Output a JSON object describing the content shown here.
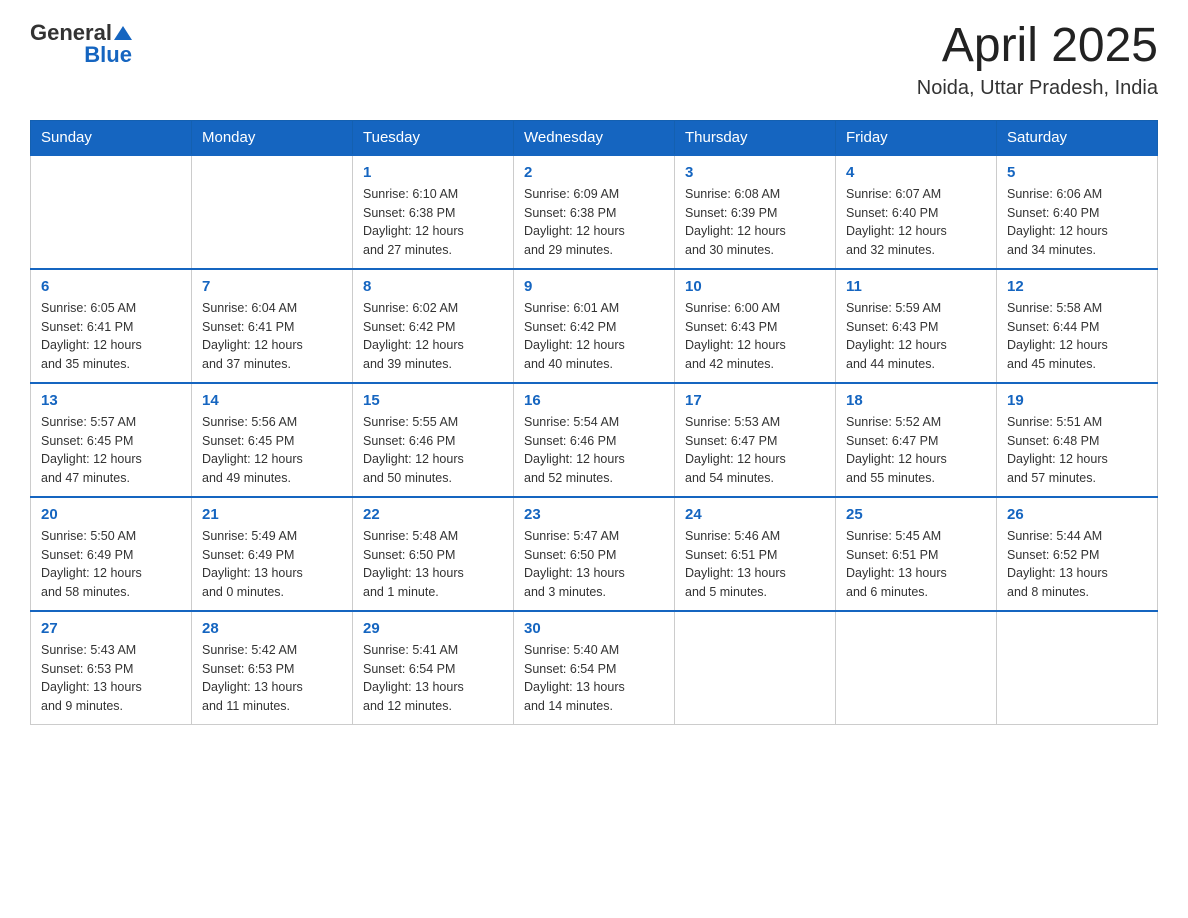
{
  "header": {
    "logo_general": "General",
    "logo_blue": "Blue",
    "title": "April 2025",
    "subtitle": "Noida, Uttar Pradesh, India"
  },
  "days_of_week": [
    "Sunday",
    "Monday",
    "Tuesday",
    "Wednesday",
    "Thursday",
    "Friday",
    "Saturday"
  ],
  "weeks": [
    [
      {
        "day": "",
        "info": ""
      },
      {
        "day": "",
        "info": ""
      },
      {
        "day": "1",
        "info": "Sunrise: 6:10 AM\nSunset: 6:38 PM\nDaylight: 12 hours\nand 27 minutes."
      },
      {
        "day": "2",
        "info": "Sunrise: 6:09 AM\nSunset: 6:38 PM\nDaylight: 12 hours\nand 29 minutes."
      },
      {
        "day": "3",
        "info": "Sunrise: 6:08 AM\nSunset: 6:39 PM\nDaylight: 12 hours\nand 30 minutes."
      },
      {
        "day": "4",
        "info": "Sunrise: 6:07 AM\nSunset: 6:40 PM\nDaylight: 12 hours\nand 32 minutes."
      },
      {
        "day": "5",
        "info": "Sunrise: 6:06 AM\nSunset: 6:40 PM\nDaylight: 12 hours\nand 34 minutes."
      }
    ],
    [
      {
        "day": "6",
        "info": "Sunrise: 6:05 AM\nSunset: 6:41 PM\nDaylight: 12 hours\nand 35 minutes."
      },
      {
        "day": "7",
        "info": "Sunrise: 6:04 AM\nSunset: 6:41 PM\nDaylight: 12 hours\nand 37 minutes."
      },
      {
        "day": "8",
        "info": "Sunrise: 6:02 AM\nSunset: 6:42 PM\nDaylight: 12 hours\nand 39 minutes."
      },
      {
        "day": "9",
        "info": "Sunrise: 6:01 AM\nSunset: 6:42 PM\nDaylight: 12 hours\nand 40 minutes."
      },
      {
        "day": "10",
        "info": "Sunrise: 6:00 AM\nSunset: 6:43 PM\nDaylight: 12 hours\nand 42 minutes."
      },
      {
        "day": "11",
        "info": "Sunrise: 5:59 AM\nSunset: 6:43 PM\nDaylight: 12 hours\nand 44 minutes."
      },
      {
        "day": "12",
        "info": "Sunrise: 5:58 AM\nSunset: 6:44 PM\nDaylight: 12 hours\nand 45 minutes."
      }
    ],
    [
      {
        "day": "13",
        "info": "Sunrise: 5:57 AM\nSunset: 6:45 PM\nDaylight: 12 hours\nand 47 minutes."
      },
      {
        "day": "14",
        "info": "Sunrise: 5:56 AM\nSunset: 6:45 PM\nDaylight: 12 hours\nand 49 minutes."
      },
      {
        "day": "15",
        "info": "Sunrise: 5:55 AM\nSunset: 6:46 PM\nDaylight: 12 hours\nand 50 minutes."
      },
      {
        "day": "16",
        "info": "Sunrise: 5:54 AM\nSunset: 6:46 PM\nDaylight: 12 hours\nand 52 minutes."
      },
      {
        "day": "17",
        "info": "Sunrise: 5:53 AM\nSunset: 6:47 PM\nDaylight: 12 hours\nand 54 minutes."
      },
      {
        "day": "18",
        "info": "Sunrise: 5:52 AM\nSunset: 6:47 PM\nDaylight: 12 hours\nand 55 minutes."
      },
      {
        "day": "19",
        "info": "Sunrise: 5:51 AM\nSunset: 6:48 PM\nDaylight: 12 hours\nand 57 minutes."
      }
    ],
    [
      {
        "day": "20",
        "info": "Sunrise: 5:50 AM\nSunset: 6:49 PM\nDaylight: 12 hours\nand 58 minutes."
      },
      {
        "day": "21",
        "info": "Sunrise: 5:49 AM\nSunset: 6:49 PM\nDaylight: 13 hours\nand 0 minutes."
      },
      {
        "day": "22",
        "info": "Sunrise: 5:48 AM\nSunset: 6:50 PM\nDaylight: 13 hours\nand 1 minute."
      },
      {
        "day": "23",
        "info": "Sunrise: 5:47 AM\nSunset: 6:50 PM\nDaylight: 13 hours\nand 3 minutes."
      },
      {
        "day": "24",
        "info": "Sunrise: 5:46 AM\nSunset: 6:51 PM\nDaylight: 13 hours\nand 5 minutes."
      },
      {
        "day": "25",
        "info": "Sunrise: 5:45 AM\nSunset: 6:51 PM\nDaylight: 13 hours\nand 6 minutes."
      },
      {
        "day": "26",
        "info": "Sunrise: 5:44 AM\nSunset: 6:52 PM\nDaylight: 13 hours\nand 8 minutes."
      }
    ],
    [
      {
        "day": "27",
        "info": "Sunrise: 5:43 AM\nSunset: 6:53 PM\nDaylight: 13 hours\nand 9 minutes."
      },
      {
        "day": "28",
        "info": "Sunrise: 5:42 AM\nSunset: 6:53 PM\nDaylight: 13 hours\nand 11 minutes."
      },
      {
        "day": "29",
        "info": "Sunrise: 5:41 AM\nSunset: 6:54 PM\nDaylight: 13 hours\nand 12 minutes."
      },
      {
        "day": "30",
        "info": "Sunrise: 5:40 AM\nSunset: 6:54 PM\nDaylight: 13 hours\nand 14 minutes."
      },
      {
        "day": "",
        "info": ""
      },
      {
        "day": "",
        "info": ""
      },
      {
        "day": "",
        "info": ""
      }
    ]
  ]
}
